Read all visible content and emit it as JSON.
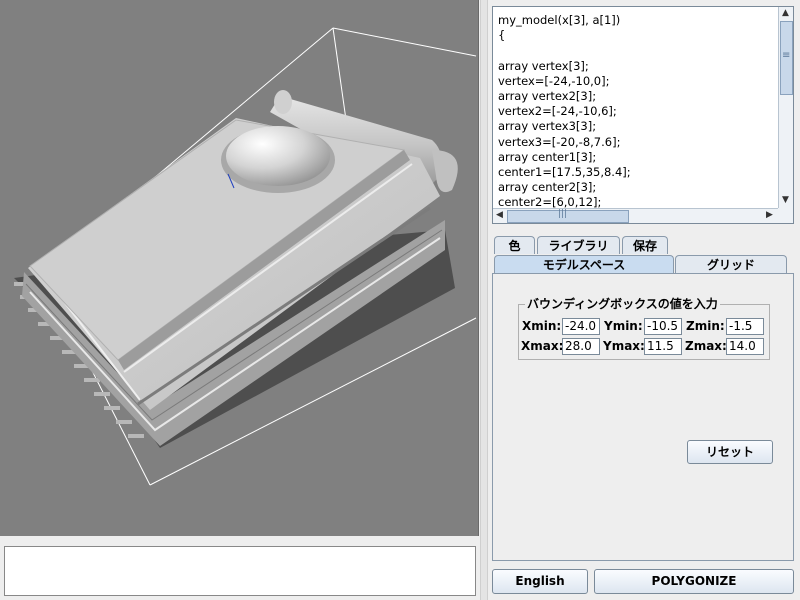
{
  "editor": {
    "code_lines": [
      "my_model(x[3], a[1])",
      "{",
      "",
      "array vertex[3];",
      "vertex=[-24,-10,0];",
      "array vertex2[3];",
      "vertex2=[-24,-10,6];",
      "array vertex3[3];",
      "vertex3=[-20,-8,7.6];",
      "array center1[3];",
      "center1=[17.5,35,8.4];",
      "array center2[3];",
      "center2=[6,0,12];"
    ]
  },
  "tabs_row1": {
    "color": "色",
    "library": "ライブラリ",
    "save": "保存"
  },
  "tabs_row2": {
    "model_space": "モデルスペース",
    "grid": "グリッド"
  },
  "bounding_box": {
    "title": "バウンディングボックスの値を入力",
    "xmin_label": "Xmin:",
    "xmin": "-24.0",
    "ymin_label": "Ymin:",
    "ymin": "-10.5",
    "zmin_label": "Zmin:",
    "zmin": "-1.5",
    "xmax_label": "Xmax:",
    "xmax": "28.0",
    "ymax_label": "Ymax:",
    "ymax": "11.5",
    "zmax_label": "Zmax:",
    "zmax": "14.0"
  },
  "buttons": {
    "reset": "リセット",
    "english": "English",
    "polygonize": "POLYGONIZE"
  },
  "icons": {
    "up": "▲",
    "down": "▼",
    "left": "◀",
    "right": "▶",
    "vgrip": "≡",
    "hgrip": "|||"
  },
  "colors": {
    "viewport_bg": "#808080",
    "model": "#c8c8c8",
    "tab_active": "#c9dcf0"
  }
}
